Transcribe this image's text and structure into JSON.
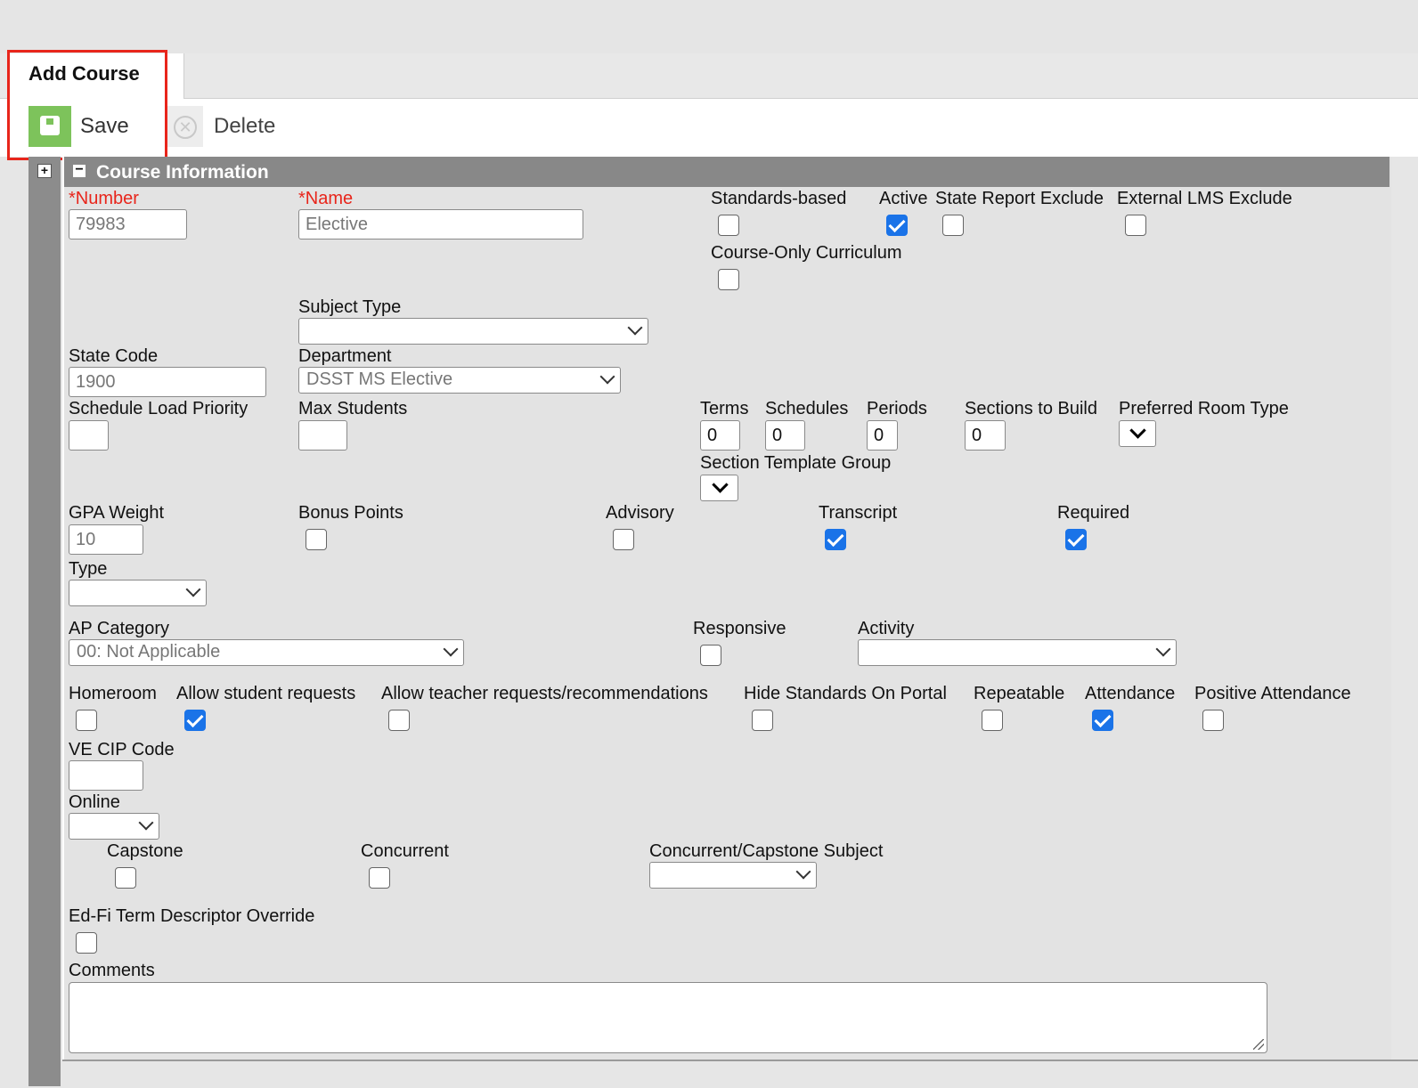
{
  "tab": {
    "title": "Add Course"
  },
  "toolbar": {
    "save_label": "Save",
    "delete_label": "Delete"
  },
  "section": {
    "title": "Course Information"
  },
  "fields": {
    "number": {
      "label": "*Number",
      "value": "79983"
    },
    "name": {
      "label": "*Name",
      "value": "Elective"
    },
    "standards_based": {
      "label": "Standards-based",
      "checked": false
    },
    "active": {
      "label": "Active",
      "checked": true
    },
    "state_report_exclude": {
      "label": "State Report Exclude",
      "checked": false
    },
    "external_lms_exclude": {
      "label": "External LMS Exclude",
      "checked": false
    },
    "course_only_curriculum": {
      "label": "Course-Only Curriculum",
      "checked": false
    },
    "subject_type": {
      "label": "Subject Type",
      "value": ""
    },
    "state_code": {
      "label": "State Code",
      "value": "1900"
    },
    "department": {
      "label": "Department",
      "value": "DSST MS Elective"
    },
    "schedule_load_priority": {
      "label": "Schedule Load Priority",
      "value": ""
    },
    "max_students": {
      "label": "Max Students",
      "value": ""
    },
    "terms": {
      "label": "Terms",
      "value": "0"
    },
    "schedules": {
      "label": "Schedules",
      "value": "0"
    },
    "periods": {
      "label": "Periods",
      "value": "0"
    },
    "sections_to_build": {
      "label": "Sections to Build",
      "value": "0"
    },
    "preferred_room_type": {
      "label": "Preferred Room Type",
      "value": ""
    },
    "section_template_group": {
      "label": "Section Template Group",
      "value": ""
    },
    "gpa_weight": {
      "label": "GPA Weight",
      "value": "10"
    },
    "bonus_points": {
      "label": "Bonus Points",
      "checked": false
    },
    "advisory": {
      "label": "Advisory",
      "checked": false
    },
    "transcript": {
      "label": "Transcript",
      "checked": true
    },
    "required": {
      "label": "Required",
      "checked": true
    },
    "type": {
      "label": "Type",
      "value": ""
    },
    "ap_category": {
      "label": "AP Category",
      "value": "00: Not Applicable"
    },
    "responsive": {
      "label": "Responsive",
      "checked": false
    },
    "activity": {
      "label": "Activity",
      "value": ""
    },
    "homeroom": {
      "label": "Homeroom",
      "checked": false
    },
    "allow_student_requests": {
      "label": "Allow student requests",
      "checked": true
    },
    "allow_teacher_requests": {
      "label": "Allow teacher requests/recommendations",
      "checked": false
    },
    "hide_standards_on_portal": {
      "label": "Hide Standards On Portal",
      "checked": false
    },
    "repeatable": {
      "label": "Repeatable",
      "checked": false
    },
    "attendance": {
      "label": "Attendance",
      "checked": true
    },
    "positive_attendance": {
      "label": "Positive Attendance",
      "checked": false
    },
    "ve_cip_code": {
      "label": "VE CIP Code",
      "value": ""
    },
    "online": {
      "label": "Online",
      "value": ""
    },
    "capstone": {
      "label": "Capstone",
      "checked": false
    },
    "concurrent": {
      "label": "Concurrent",
      "checked": false
    },
    "concurrent_capstone_subject": {
      "label": "Concurrent/Capstone Subject",
      "value": ""
    },
    "edfi_term_override": {
      "label": "Ed-Fi Term Descriptor Override",
      "checked": false
    },
    "comments": {
      "label": "Comments",
      "value": ""
    }
  },
  "colors": {
    "required_label": "#e8251b",
    "checkbox_checked": "#1a73e8",
    "save_icon": "#7dc35b",
    "highlight": "#e8251b"
  },
  "icons": {
    "save": "floppy-disk-icon",
    "delete": "circle-x-icon",
    "expand": "plus-square-icon",
    "collapse": "minus-square-icon"
  }
}
